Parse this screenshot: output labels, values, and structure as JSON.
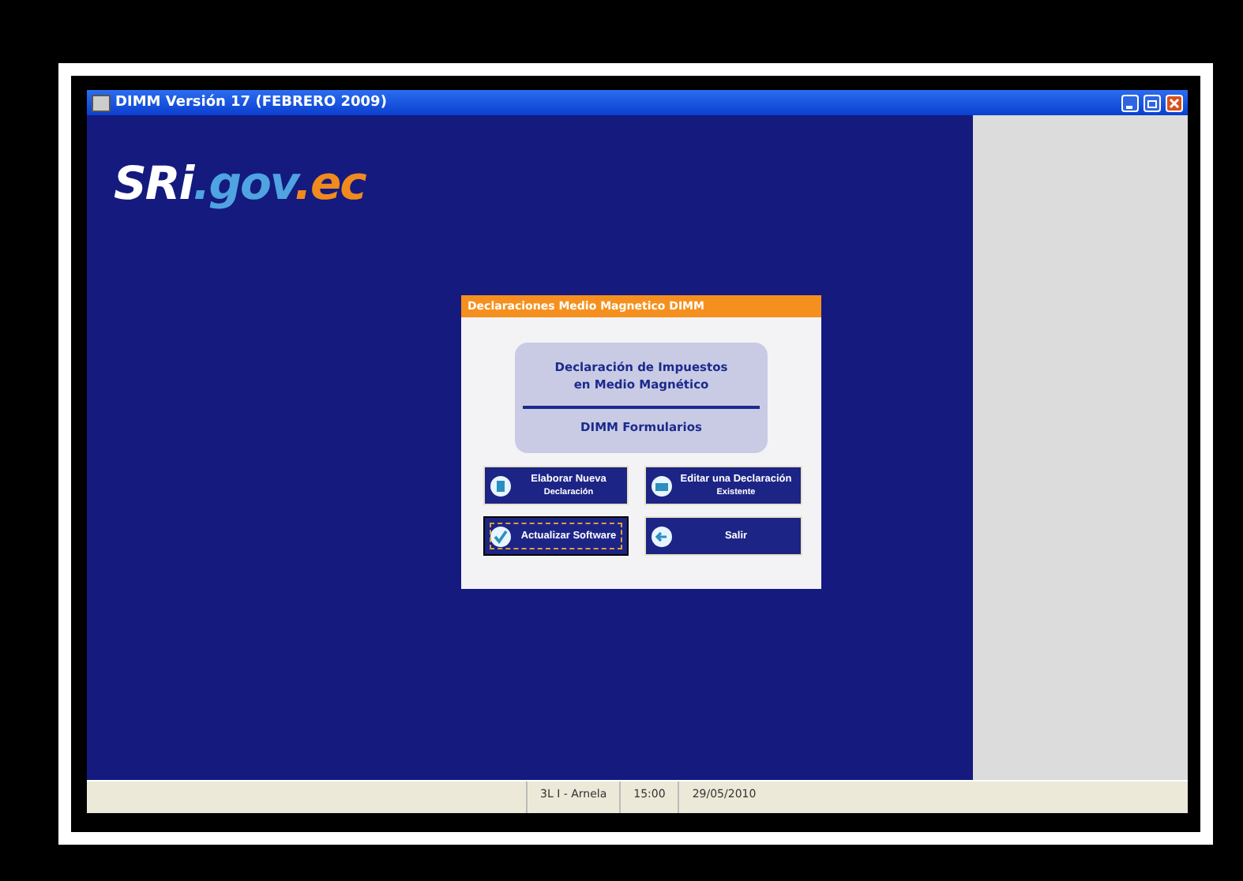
{
  "window": {
    "title": "DIMM Versión 17 (FEBRERO 2009)"
  },
  "logo": [
    "SRi",
    ".gov",
    ".ec"
  ],
  "dialog": {
    "title": "Declaraciones Medio Magnetico DIMM",
    "heading": "Declaración de Impuestos en Medio Magnético",
    "subheading": "DIMM Formularios",
    "buttons": [
      {
        "kind": "doc",
        "line1": "Elaborar Nueva",
        "line2": "Declaración",
        "selected": false
      },
      {
        "kind": "folder",
        "line1": "Editar una Declaración",
        "line2": "Existente",
        "selected": false
      },
      {
        "kind": "check",
        "line1": "Actualizar Software",
        "selected": true
      },
      {
        "kind": "back",
        "line1": "Salir",
        "selected": false
      }
    ]
  },
  "status_bar": [
    "3L I - Arnela",
    "15:00",
    "29/05/2010"
  ]
}
